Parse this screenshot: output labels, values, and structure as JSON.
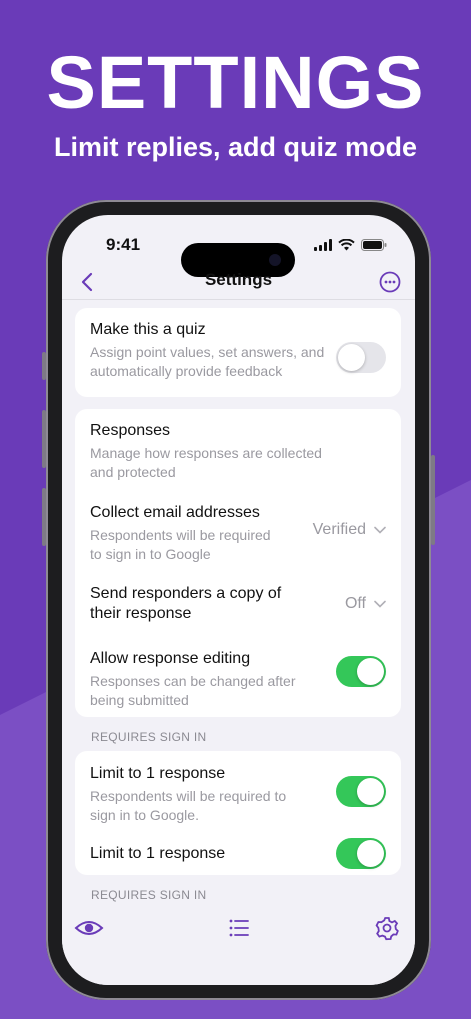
{
  "hero": {
    "title": "SETTINGS",
    "subtitle": "Limit replies, add quiz mode"
  },
  "colors": {
    "background": "#6a3bb8",
    "accent": "#6a3bb8",
    "toggle_on": "#34c759",
    "toggle_off": "#e5e5ea"
  },
  "status_bar": {
    "time": "9:41",
    "icons": [
      "signal-icon",
      "wifi-icon",
      "battery-icon"
    ]
  },
  "nav": {
    "title": "Settings",
    "back_icon": "chevron-left-icon",
    "more_icon": "more-circle-icon"
  },
  "quiz_card": {
    "title": "Make this a quiz",
    "description": "Assign point values, set answers, and automatically provide feedback",
    "toggle_on": false
  },
  "responses_card": {
    "header_title": "Responses",
    "header_description": "Manage how responses are collected and protected",
    "collect_email": {
      "title": "Collect email addresses",
      "description": "Respondents will be required to sign in to Google",
      "value": "Verified"
    },
    "send_copy": {
      "title": "Send responders a copy of their response",
      "value": "Off"
    },
    "allow_editing": {
      "title": "Allow response editing",
      "description": "Responses can be changed after being submitted",
      "toggle_on": true
    }
  },
  "requires_sign_in_1": "REQUIRES SIGN IN",
  "limit_card": {
    "row1": {
      "title": "Limit to 1 response",
      "description": "Respondents will be required to sign in to Google.",
      "toggle_on": true
    },
    "row2": {
      "title": "Limit to 1 response",
      "toggle_on": true
    }
  },
  "requires_sign_in_2": "REQUIRES SIGN IN",
  "tabbar": {
    "icons": [
      "eye-icon",
      "list-icon",
      "gear-icon"
    ]
  }
}
